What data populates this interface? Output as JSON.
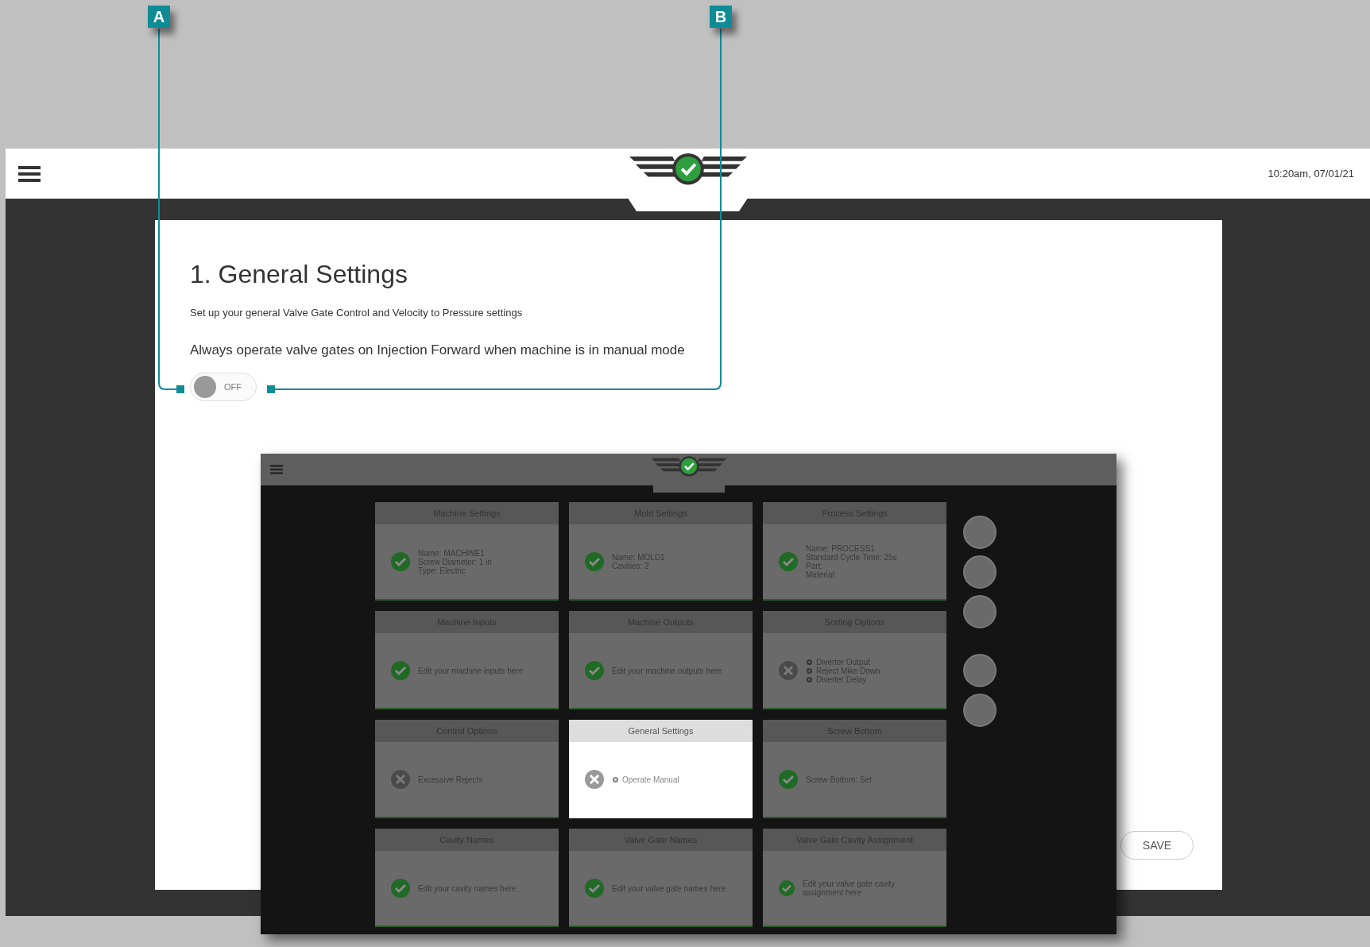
{
  "header": {
    "time": "10:20am, 07/01/21"
  },
  "settings": {
    "title": "1. General Settings",
    "subtitle": "Set up your general Valve Gate Control and Velocity to Pressure settings",
    "option_label": "Always operate valve gates on Injection Forward when machine is in manual mode",
    "toggle": {
      "on": false,
      "label": "OFF"
    }
  },
  "save_button": "SAVE",
  "inset": {
    "cards": [
      {
        "title": "Machine Settings",
        "kind": "done",
        "items": [
          {
            "text": "Name: MACHINE1",
            "kind": "plain"
          },
          {
            "text": "Screw Diameter: 1 in",
            "kind": "plain"
          },
          {
            "text": "Type: Electric",
            "kind": "plain"
          }
        ],
        "selected": false
      },
      {
        "title": "Mold Settings",
        "kind": "done",
        "items": [
          {
            "text": "Name: MOLD1",
            "kind": "plain"
          },
          {
            "text": "Cavities: 2",
            "kind": "plain"
          }
        ],
        "selected": false
      },
      {
        "title": "Process Settings",
        "kind": "done",
        "items": [
          {
            "text": "Name: PROCESS1",
            "kind": "plain"
          },
          {
            "text": "Standard Cycle Time: 25s",
            "kind": "plain"
          },
          {
            "text": "Part:",
            "kind": "plain"
          },
          {
            "text": "Material:",
            "kind": "plain"
          }
        ],
        "selected": false
      },
      {
        "title": "Machine Inputs",
        "kind": "done",
        "items": [
          {
            "text": "Edit your machine inputs here",
            "kind": "plain"
          }
        ],
        "selected": false
      },
      {
        "title": "Machine Outputs",
        "kind": "done",
        "items": [
          {
            "text": "Edit your machine outputs here",
            "kind": "plain"
          }
        ],
        "selected": false
      },
      {
        "title": "Sorting Options",
        "kind": "error",
        "items": [
          {
            "text": "Diverter Output",
            "kind": "bullet"
          },
          {
            "text": "Reject Mike Down",
            "kind": "bullet"
          },
          {
            "text": "Diverter Delay",
            "kind": "bullet"
          }
        ],
        "selected": false
      },
      {
        "title": "Control Options",
        "kind": "error",
        "items": [
          {
            "text": "Excessive Rejects",
            "kind": "plain"
          }
        ],
        "selected": false
      },
      {
        "title": "General Settings",
        "kind": "error",
        "items": [
          {
            "text": "Operate Manual",
            "kind": "bullet"
          }
        ],
        "selected": true
      },
      {
        "title": "Screw Bottom",
        "kind": "done",
        "items": [
          {
            "text": "Screw Bottom: Set",
            "kind": "plain"
          }
        ],
        "selected": false
      },
      {
        "title": "Cavity Names",
        "kind": "done",
        "items": [
          {
            "text": "Edit your cavity names here",
            "kind": "plain"
          }
        ],
        "selected": false
      },
      {
        "title": "Valve Gate Names",
        "kind": "done",
        "items": [
          {
            "text": "Edit your valve gate names here",
            "kind": "plain"
          }
        ],
        "selected": false
      },
      {
        "title": "Valve Gate Cavity Assignment",
        "kind": "done",
        "items": [
          {
            "text": "Edit your valve gate cavity assignment here",
            "kind": "plain"
          }
        ],
        "selected": false
      }
    ]
  },
  "callouts": [
    {
      "label": "A"
    },
    {
      "label": "B"
    }
  ]
}
